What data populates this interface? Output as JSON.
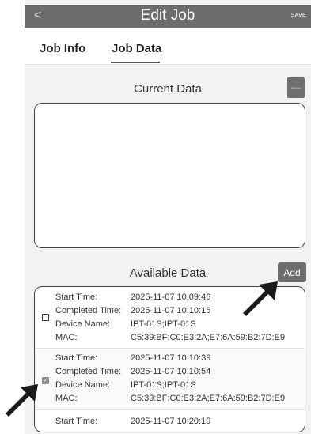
{
  "header": {
    "back_glyph": "<",
    "title": "Edit Job",
    "save_label": "SAVE"
  },
  "tabs": [
    {
      "label": "Job Info",
      "selected": false
    },
    {
      "label": "Job Data",
      "selected": true
    }
  ],
  "current_data": {
    "title": "Current Data",
    "remove_label": "Remove",
    "items": []
  },
  "available_data": {
    "title": "Available Data",
    "add_label": "Add",
    "field_labels": {
      "start": "Start Time:",
      "completed": "Completed Time:",
      "device": "Device Name:",
      "mac": "MAC:"
    },
    "items": [
      {
        "checked": false,
        "start": "2025-11-07 10:09:46",
        "completed": "2025-11-07 10:10:16",
        "device": "IPT-01S;IPT-01S",
        "mac": "C5:39:BF:C0:E3:2A;E7:6A:59:B2:7D:E9"
      },
      {
        "checked": true,
        "start": "2025-11-07 10:10:39",
        "completed": "2025-11-07 10:10:54",
        "device": "IPT-01S;IPT-01S",
        "mac": "C5:39:BF:C0:E3:2A;E7:6A:59:B2:7D:E9"
      },
      {
        "checked": false,
        "start": "2025-11-07 10:20:19"
      }
    ]
  },
  "colors": {
    "toolbar": "#6d6d6d",
    "button": "#6d6d6d",
    "background": "#f2f2f2",
    "arrow": "#1a1a1a"
  }
}
